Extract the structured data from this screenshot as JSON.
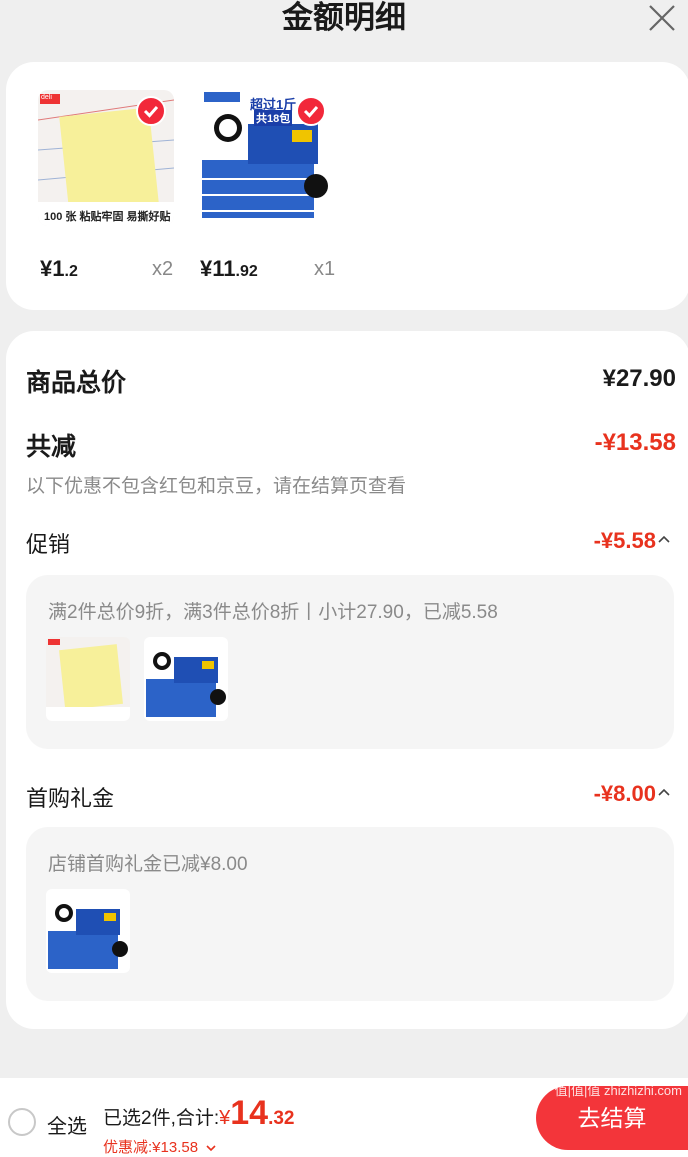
{
  "header": {
    "title": "金额明细"
  },
  "items": [
    {
      "price_currency": "¥",
      "price_int": "1",
      "price_dec": ".2",
      "qty": "x2",
      "brand": "deli",
      "caption": "100 张 粘贴牢固 易撕好贴"
    },
    {
      "price_currency": "¥",
      "price_int": "11",
      "price_dec": ".92",
      "qty": "x1",
      "promo_line1": "超过1斤",
      "promo_line2": "共18包"
    }
  ],
  "summary": {
    "total_label": "商品总价",
    "total_value": "¥27.90",
    "discount_label": "共减",
    "discount_value": "-¥13.58",
    "note": "以下优惠不包含红包和京豆，请在结算页查看"
  },
  "promotion": {
    "label": "促销",
    "value": "-¥5.58",
    "detail": "满2件总价9折，满3件总价8折丨小计27.90，已减5.58"
  },
  "first_purchase": {
    "label": "首购礼金",
    "value": "-¥8.00",
    "detail": "店铺首购礼金已减¥8.00"
  },
  "footer": {
    "select_all": "全选",
    "selected_text": "已选2件,合计:",
    "currency": "¥",
    "total_int": "14",
    "total_dec": ".32",
    "savings": "优惠减:¥13.58",
    "checkout": "去结算",
    "watermark": "值|值|值 zhizhizhi.com"
  },
  "colors": {
    "accent": "#e8321e",
    "checkout_bg": "#f3353a",
    "panel_bg": "#f5f5f5"
  },
  "icons": [
    "close-icon",
    "check-icon",
    "chevron-up-icon",
    "chevron-down-icon"
  ]
}
